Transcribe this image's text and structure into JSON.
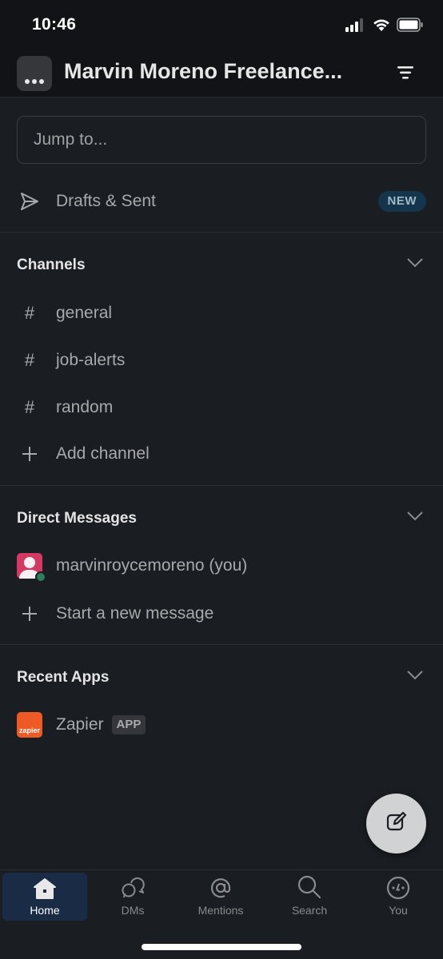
{
  "status_bar": {
    "time": "10:46",
    "icons": [
      "cellular-signal-icon",
      "wifi-icon",
      "battery-icon"
    ]
  },
  "header": {
    "workspace_button_label": "...",
    "workspace_name": "Marvin Moreno Freelance...",
    "filter_icon": "filter-icon"
  },
  "jump_to": {
    "placeholder": "Jump to..."
  },
  "drafts": {
    "label": "Drafts & Sent",
    "badge": "NEW",
    "icon": "paper-plane-icon"
  },
  "sections": {
    "channels": {
      "title": "Channels",
      "items": [
        {
          "prefix": "#",
          "label": "general"
        },
        {
          "prefix": "#",
          "label": "job-alerts"
        },
        {
          "prefix": "#",
          "label": "random"
        }
      ],
      "add_label": "Add channel"
    },
    "direct_messages": {
      "title": "Direct Messages",
      "items": [
        {
          "label": "marvinroycemoreno (you)",
          "presence": "active"
        }
      ],
      "add_label": "Start a new message"
    },
    "recent_apps": {
      "title": "Recent Apps",
      "items": [
        {
          "label": "Zapier",
          "tag": "APP",
          "logo_text": "zapier"
        }
      ]
    }
  },
  "fab": {
    "icon": "compose-icon"
  },
  "tabbar": {
    "tabs": [
      {
        "label": "Home",
        "icon": "home-icon",
        "active": true
      },
      {
        "label": "DMs",
        "icon": "dms-icon",
        "active": false
      },
      {
        "label": "Mentions",
        "icon": "at-mention-icon",
        "active": false
      },
      {
        "label": "Search",
        "icon": "search-icon",
        "active": false
      },
      {
        "label": "You",
        "icon": "you-icon",
        "active": false
      }
    ]
  },
  "colors": {
    "background": "#1a1d21",
    "header_background": "#121316",
    "active_tab": "#1a2b45",
    "new_badge": "#14354b",
    "avatar": "#d33a63",
    "presence_active": "#2d7d5a",
    "zapier_brand": "#ee5a25"
  }
}
